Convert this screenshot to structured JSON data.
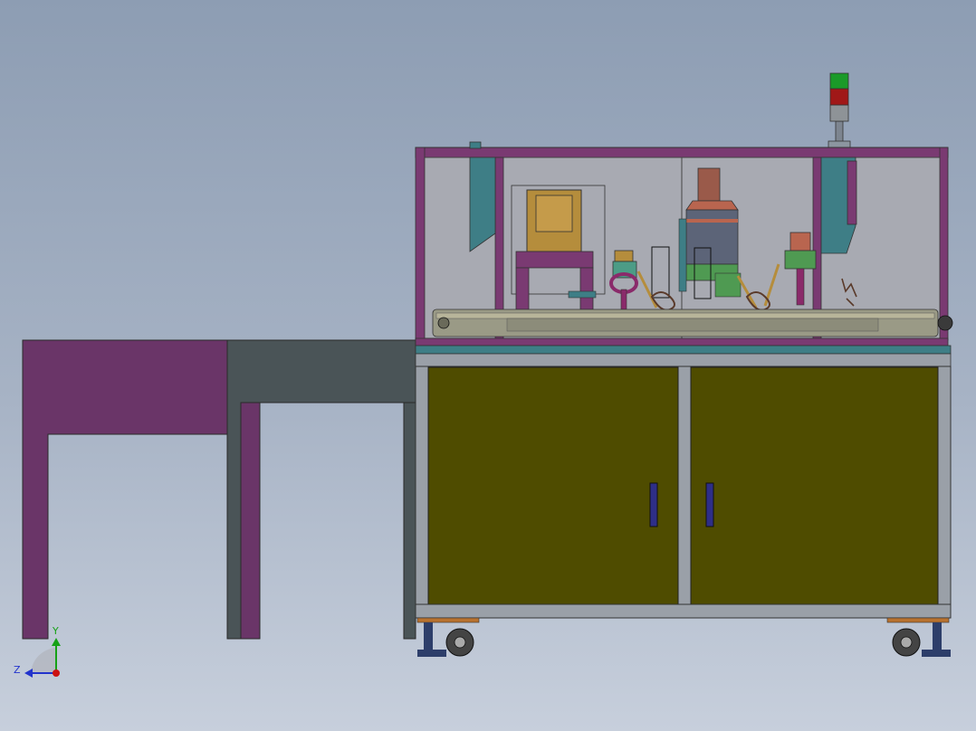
{
  "viewport": {
    "background_top": "#8d9db3",
    "background_bottom": "#c7cfdc"
  },
  "colors": {
    "magenta_frame": "#6a3568",
    "slate_table": "#4a5457",
    "teal_panel": "#3e7e86",
    "cabinet_door": "#4f4c00",
    "aluminum_frame": "#9aa0a8",
    "glass": "#a8aab2",
    "gold_part": "#b58d3c",
    "handle_blue": "#2e2e88",
    "signal_green": "#1a9a28",
    "signal_red": "#a01818",
    "axis_y": "#17a117",
    "axis_z": "#2233cc",
    "axis_x": "#cc1111"
  },
  "machine": {
    "signal_tower_lights": [
      "green",
      "red"
    ],
    "door_count": 2,
    "caster_count": 2
  },
  "triad": {
    "y_label": "Y",
    "z_label": "Z"
  }
}
